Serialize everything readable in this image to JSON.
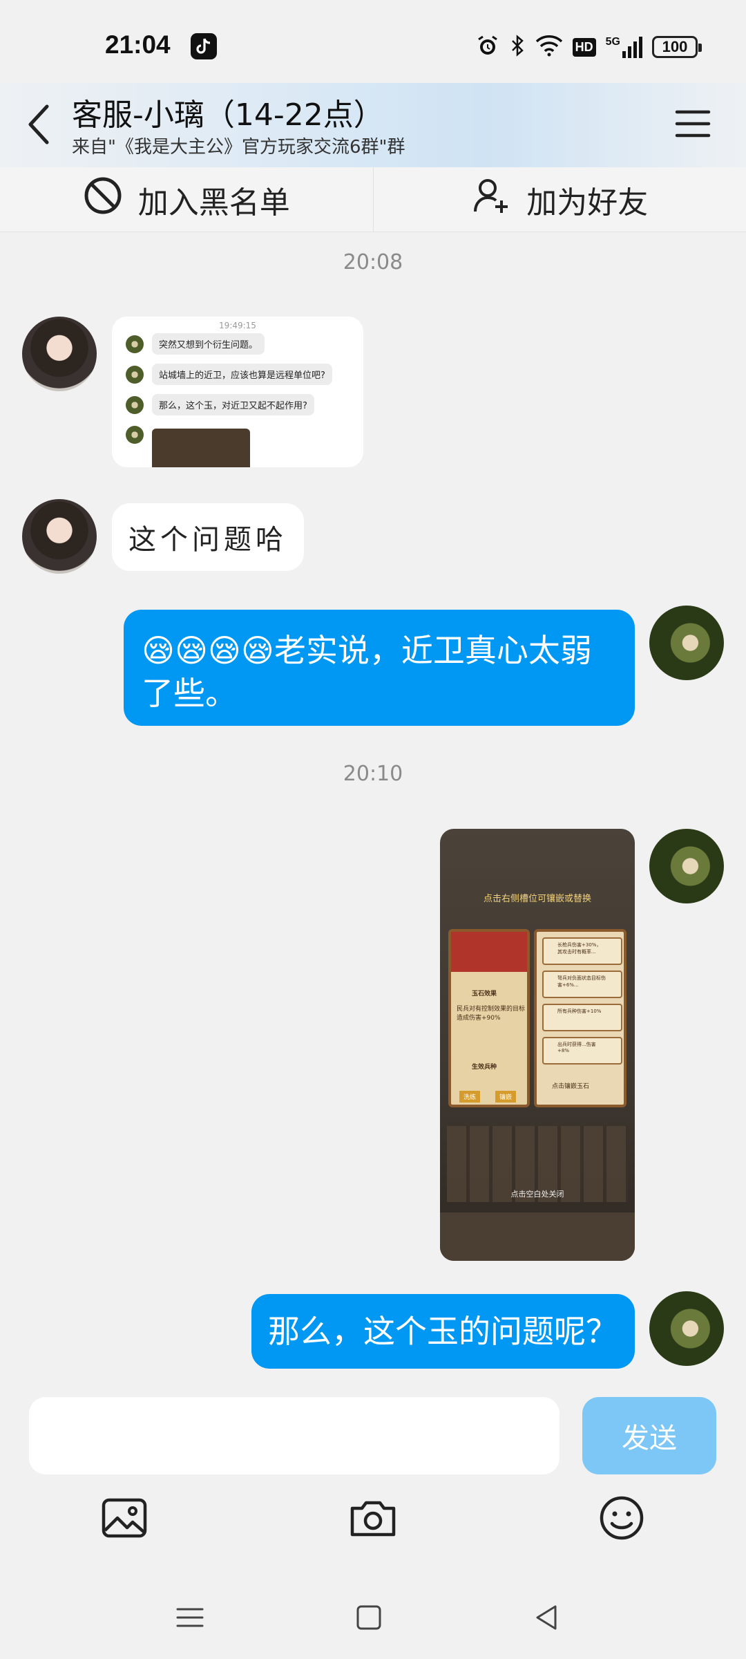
{
  "status_bar": {
    "time": "21:04",
    "network": "5G",
    "hd": "HD",
    "battery": "100"
  },
  "header": {
    "title": "客服-小璃（14-22点）",
    "subtitle": "来自\"《我是大主公》官方玩家交流6群\"群"
  },
  "actions": {
    "blacklist_label": "加入黑名单",
    "add_friend_label": "加为好友"
  },
  "messages": {
    "ts1": "20:08",
    "ts2": "20:10",
    "shot": {
      "time": "19:49:15",
      "lines": [
        "突然又想到个衍生问题。",
        "站城墙上的近卫，应该也算是远程单位吧?",
        "那么，这个玉，对近卫又起不起作用?"
      ]
    },
    "msg_left_2": "这个问题哈",
    "msg_right_1": "😪😪😪😪老实说，近卫真心太弱了些。",
    "msg_right_3": "那么，这个玉的问题呢？",
    "game": {
      "banner": "点击右侧槽位可镶嵌或替换",
      "gem_effect": "玉石效果",
      "effect_desc": "民兵对有控制效果的目标造成伤害+90%",
      "active_troop": "生效兵种",
      "equip_btn": "洗练",
      "swap_btn": "镶嵌",
      "slot_hint": "点击镶嵌玉石",
      "close_hint": "点击空白处关闭",
      "slot_lines": [
        "长枪兵伤害+30%，其攻击时有概率...",
        "弩兵对负面状态目标伤害+6%...",
        "所有兵种伤害+10%",
        "出兵时获得...伤害+8%"
      ]
    }
  },
  "input": {
    "placeholder": "",
    "send_label": "发送"
  },
  "icons": {
    "back": "back-arrow-icon",
    "menu": "hamburger-menu-icon",
    "block": "block-icon",
    "add_user": "add-user-icon",
    "image": "image-icon",
    "camera": "camera-icon",
    "emoji": "emoji-icon"
  },
  "colors": {
    "accent": "#0098f2",
    "send_disabled": "#7cc7f5",
    "background": "#f1f1f1"
  }
}
